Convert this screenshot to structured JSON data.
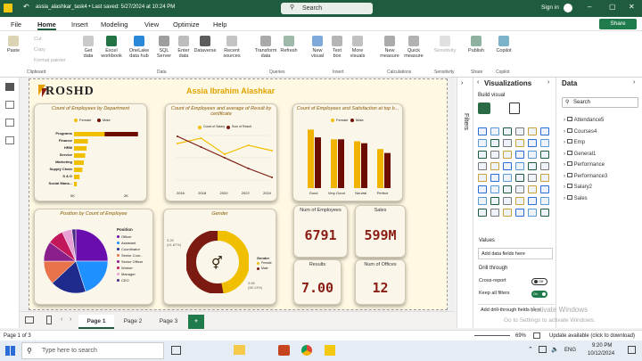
{
  "window": {
    "file_title": "assia_alashkar_task4 • Last saved: 5/27/2024 at 10:24 PM",
    "search_placeholder": "Search",
    "signin": "Sign in",
    "share": "Share"
  },
  "menu": {
    "items": [
      "File",
      "Home",
      "Insert",
      "Modeling",
      "View",
      "Optimize",
      "Help"
    ]
  },
  "ribbon": {
    "clipboard": {
      "paste": "Paste",
      "cut": "Cut",
      "copy": "Copy",
      "format_painter": "Format painter",
      "group": "Clipboard"
    },
    "data": {
      "buttons": [
        "Get data",
        "Excel workbook",
        "OneLake data hub",
        "SQL Server",
        "Enter data",
        "Dataverse",
        "Recent sources"
      ],
      "group": "Data"
    },
    "queries": {
      "buttons": [
        "Transform data",
        "Refresh"
      ],
      "group": "Queries"
    },
    "insert": {
      "buttons": [
        "New visual",
        "Text box",
        "More visuals"
      ],
      "group": "Insert"
    },
    "calculations": {
      "buttons": [
        "New measure",
        "Quick measure"
      ],
      "group": "Calculations"
    },
    "sensitivity": {
      "buttons": [
        "Sensitivity"
      ],
      "group": "Sensitivity"
    },
    "share": {
      "buttons": [
        "Publish"
      ],
      "group": "Share"
    },
    "copilot": {
      "buttons": [
        "Copilot"
      ],
      "group": "Copilot"
    }
  },
  "report": {
    "logo": "ROSHD",
    "author": "Assia Ibrahim Alashkar",
    "dept_chart": {
      "title": "Count of Employees by Department",
      "legend": [
        "Female",
        "Male"
      ],
      "categories": [
        "Programs",
        "Finance",
        "HRM",
        "Service",
        "Marketing",
        "Supply Chain",
        "S & D",
        "Social Mana..."
      ],
      "axis_ticks": [
        "0K",
        "2K"
      ]
    },
    "result_chart": {
      "title": "Count of Employees and average of Result by certificate",
      "legend": [
        "Count of Salary",
        "Sum of Result"
      ],
      "x_ticks": [
        "2016",
        "2018",
        "2020",
        "2022",
        "2024"
      ]
    },
    "sat_chart": {
      "title": "Count of Employees and Satisfaction at top b...",
      "legend": [
        "Female",
        "Male"
      ],
      "categories": [
        "Good",
        "Very Good",
        "Neutral",
        "Perfect"
      ]
    },
    "position_chart": {
      "title": "Position by Count of Employee",
      "legend_title": "Position",
      "legend": [
        "Officer",
        "Assistant",
        "Coordinator",
        "Senior Coor...",
        "Senior Officer",
        "Worker",
        "Manager",
        "CEO"
      ]
    },
    "gender_chart": {
      "title": "Gender",
      "label_left": "3.2K\n(41.87%)",
      "label_right": "3.6K\n(58.13%)",
      "legend_title": "Gender",
      "legend": [
        "Female",
        "Male"
      ]
    },
    "kpis": [
      {
        "label": "Num of Employees",
        "value": "6791"
      },
      {
        "label": "Sales",
        "value": "599M"
      },
      {
        "label": "Results",
        "value": "7.00"
      },
      {
        "label": "Num of Offices",
        "value": "12"
      }
    ]
  },
  "chart_data": [
    {
      "type": "bar",
      "title": "Count of Employees by Department",
      "categories": [
        "Programs",
        "Finance",
        "HRM",
        "Service",
        "Marketing",
        "Supply Chain",
        "S & D",
        "Social Mana..."
      ],
      "series": [
        {
          "name": "Female",
          "values": [
            1.1,
            0.5,
            0.45,
            0.4,
            0.35,
            0.3,
            0.2,
            0.1
          ]
        },
        {
          "name": "Male",
          "values": [
            1.2,
            0,
            0,
            0,
            0,
            0,
            0,
            0
          ]
        }
      ]
    },
    {
      "type": "line",
      "title": "Count of Employees and average of Result by certificate",
      "x": [
        "2016",
        "2018",
        "2020",
        "2022",
        "2024"
      ],
      "series": [
        {
          "name": "Count of Salary",
          "values": [
            1200,
            1350,
            900,
            1150,
            1000
          ]
        },
        {
          "name": "Sum of Result",
          "values": [
            1400,
            1100,
            800,
            500,
            250
          ]
        }
      ]
    },
    {
      "type": "bar",
      "title": "Count of Employees and Satisfaction at top b...",
      "categories": [
        "Good",
        "Very Good",
        "Neutral",
        "Perfect"
      ],
      "series": [
        {
          "name": "Female",
          "values": [
            1500,
            1250,
            1200,
            1000
          ]
        },
        {
          "name": "Male",
          "values": [
            1300,
            1250,
            1150,
            900
          ]
        }
      ]
    },
    {
      "type": "pie",
      "title": "Position by Count of Employee",
      "categories": [
        "Officer",
        "Assistant",
        "Coordinator",
        "Senior Coor...",
        "Senior Officer",
        "Worker",
        "Manager",
        "CEO"
      ],
      "values": [
        25,
        20,
        18,
        12,
        10,
        8,
        5,
        2
      ]
    },
    {
      "type": "pie",
      "title": "Gender",
      "categories": [
        "Female",
        "Male"
      ],
      "values": [
        3.2,
        3.6
      ]
    }
  ],
  "pages": {
    "tabs": [
      "Page 1",
      "Page 2",
      "Page 3"
    ],
    "add": "+",
    "status": "Page 1 of 3",
    "zoom": "69%",
    "update": "Update available (click to download)"
  },
  "filters": {
    "label": "Filters"
  },
  "viz": {
    "title": "Visualizations",
    "build": "Build visual",
    "values": "Values",
    "values_field": "Add data fields here",
    "drill": "Drill through",
    "cross_report": "Cross-report",
    "cross_state": "Off",
    "keep_filters": "Keep all filters",
    "keep_state": "On",
    "drill_field": "Add drill-through fields here"
  },
  "data_pane": {
    "title": "Data",
    "search": "Search",
    "tables": [
      "Attendance5",
      "Courses4",
      "Emp",
      "General1",
      "Performance",
      "Performance3",
      "Salary2",
      "Sales"
    ]
  },
  "watermark": {
    "line1": "Activate Windows",
    "line2": "Go to Settings to activate Windows."
  },
  "taskbar": {
    "search": "Type here to search",
    "lang": "ENG",
    "time": "9:20 PM",
    "date": "10/12/2024"
  }
}
